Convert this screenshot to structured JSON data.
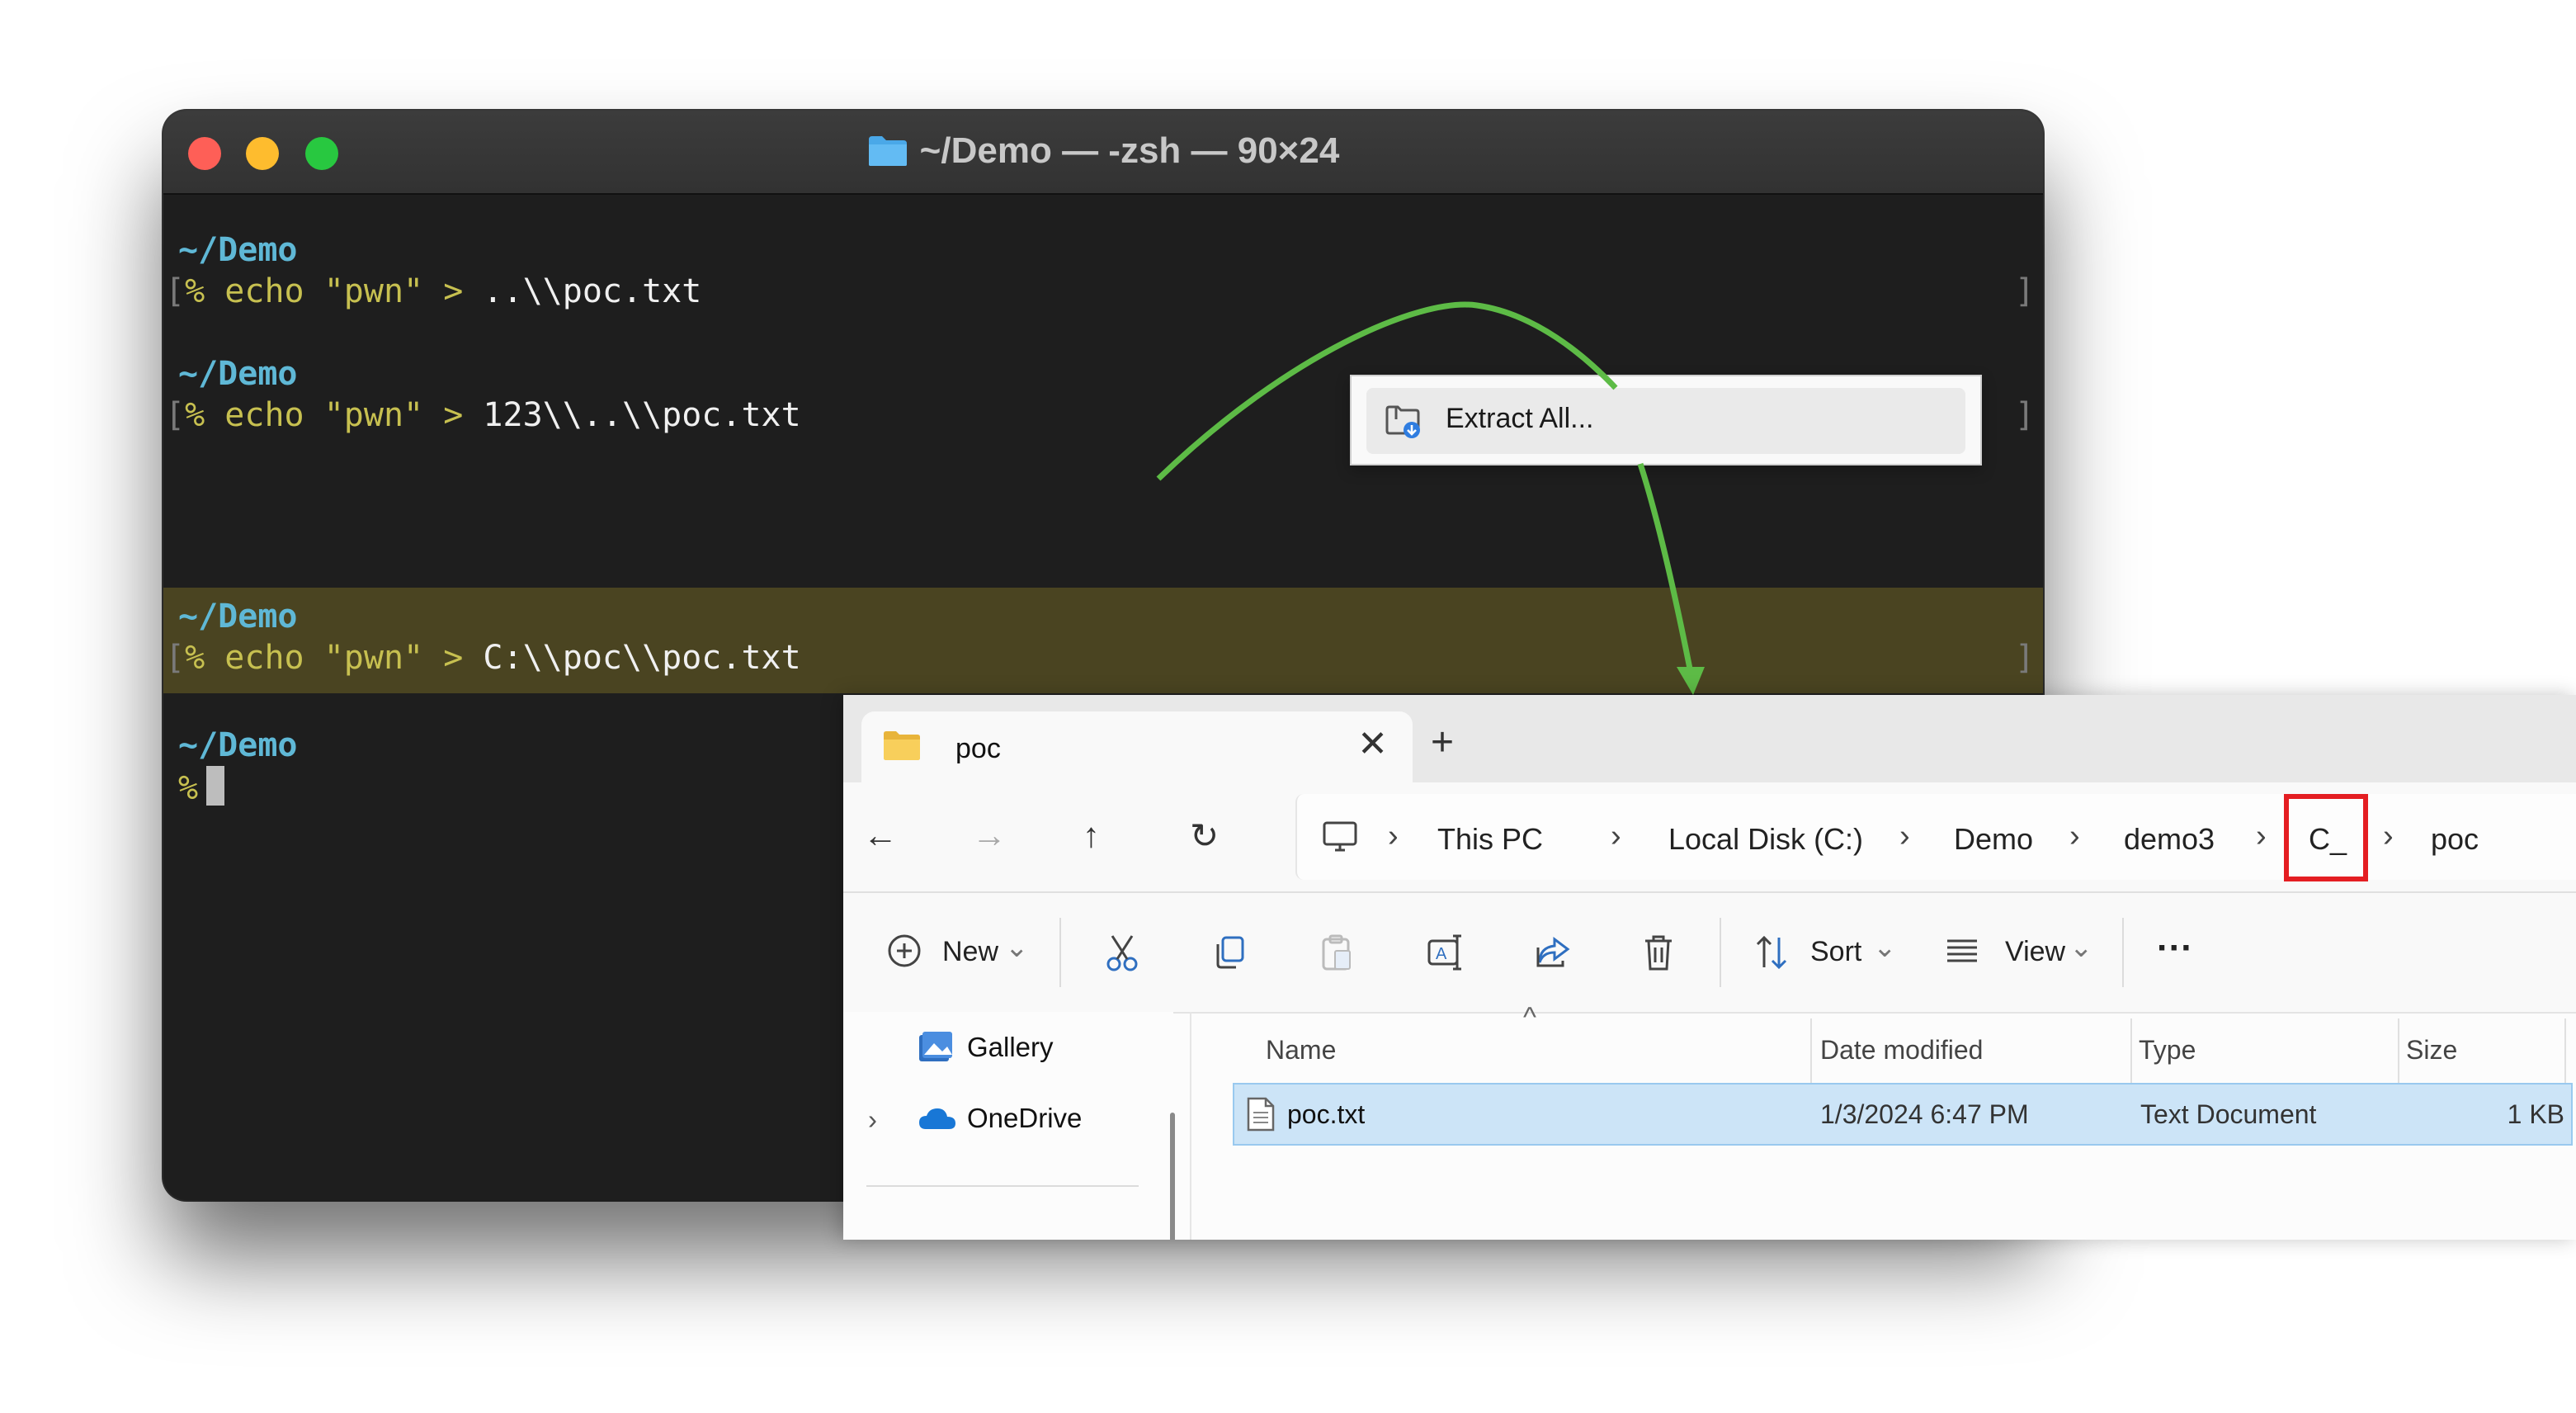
{
  "terminal": {
    "title": "~/Demo — -zsh — 90×24",
    "blocks": [
      {
        "dir": "~/Demo",
        "prompt": "%",
        "cmd": "echo",
        "str": "\"pwn\"",
        "gt": ">",
        "arg": "..\\\\poc.txt"
      },
      {
        "dir": "~/Demo",
        "prompt": "%",
        "cmd": "echo",
        "str": "\"pwn\"",
        "gt": ">",
        "arg": "123\\\\..\\\\poc.txt"
      },
      {
        "dir": "~/Demo",
        "prompt": "%",
        "cmd": "echo",
        "str": "\"pwn\"",
        "gt": ">",
        "arg": "C:\\\\poc\\\\poc.txt"
      },
      {
        "dir": "~/Demo",
        "prompt": "%"
      }
    ],
    "bracket_open": "[",
    "bracket_close": "]"
  },
  "context_menu": {
    "item_label": "Extract All...",
    "icon": "extract-folder-icon"
  },
  "explorer": {
    "tab": {
      "title": "poc",
      "close": "✕",
      "new_tab": "+"
    },
    "nav": {
      "back": "←",
      "forward": "→",
      "up": "↑",
      "refresh": "↻"
    },
    "breadcrumbs": [
      "This PC",
      "Local Disk (C:)",
      "Demo",
      "demo3",
      "C_",
      "poc"
    ],
    "crumb_sep": "›",
    "highlighted_crumb": "C_",
    "toolbar": {
      "new_label": "New",
      "sort_label": "Sort",
      "view_label": "View",
      "more_label": "···",
      "caret": "⌄"
    },
    "sidebar": {
      "items": [
        {
          "label": "Gallery",
          "icon": "gallery-icon"
        },
        {
          "label": "OneDrive",
          "icon": "onedrive-cloud-icon",
          "expander": "›"
        }
      ]
    },
    "columns": [
      "Name",
      "Date modified",
      "Type",
      "Size"
    ],
    "sort_caret": "^",
    "files": [
      {
        "name": "poc.txt",
        "date_modified": "1/3/2024 6:47 PM",
        "type": "Text Document",
        "size": "1 KB"
      }
    ]
  },
  "colors": {
    "arrow": "#5dbb46",
    "highlight_box": "#e41e22",
    "selection": "#cce4f7",
    "term_highlight": "#4a4421",
    "term_dir": "#5fb8d6",
    "term_cmd": "#c7c050"
  }
}
